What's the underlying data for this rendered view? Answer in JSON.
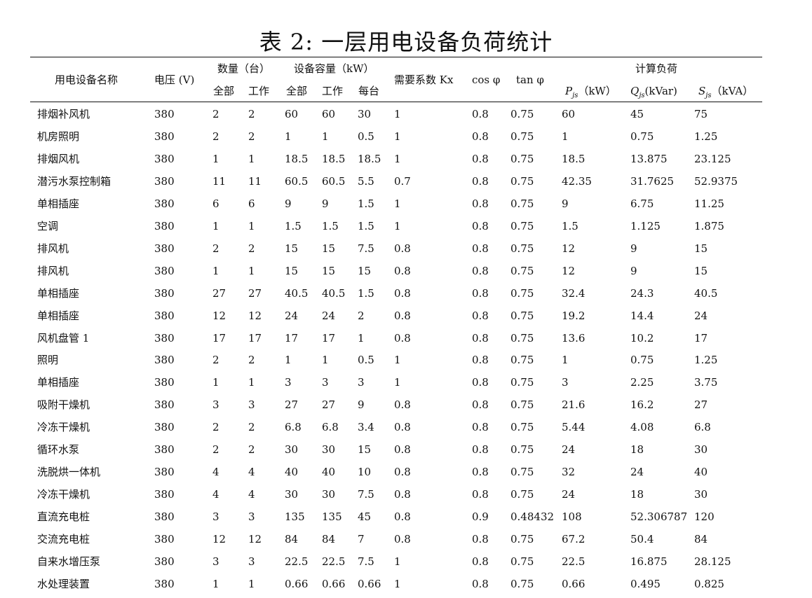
{
  "title": "表 2: 一层用电设备负荷统计",
  "header": {
    "name": "用电设备名称",
    "voltage": "电压 (V)",
    "quantity": "数量（台）",
    "qty_all": "全部",
    "qty_work": "工作",
    "capacity": "设备容量（kW）",
    "cap_all": "全部",
    "cap_work": "工作",
    "cap_each": "每台",
    "kx": "需要系数 Kx",
    "cos": "cos φ",
    "tan": "tan φ",
    "calc": "计算负荷",
    "pjs_symbol": "P",
    "pjs_sub": "js",
    "pjs_unit": "（kW）",
    "qjs_symbol": "Q",
    "qjs_sub": "js",
    "qjs_unit": "(kVar)",
    "sjs_symbol": "S",
    "sjs_sub": "js",
    "sjs_unit": "（kVA）"
  },
  "rows": [
    [
      "排烟补风机",
      "380",
      "2",
      "2",
      "60",
      "60",
      "30",
      "1",
      "0.8",
      "0.75",
      "60",
      "45",
      "75"
    ],
    [
      "机房照明",
      "380",
      "2",
      "2",
      "1",
      "1",
      "0.5",
      "1",
      "0.8",
      "0.75",
      "1",
      "0.75",
      "1.25"
    ],
    [
      "排烟风机",
      "380",
      "1",
      "1",
      "18.5",
      "18.5",
      "18.5",
      "1",
      "0.8",
      "0.75",
      "18.5",
      "13.875",
      "23.125"
    ],
    [
      "潜污水泵控制箱",
      "380",
      "11",
      "11",
      "60.5",
      "60.5",
      "5.5",
      "0.7",
      "0.8",
      "0.75",
      "42.35",
      "31.7625",
      "52.9375"
    ],
    [
      "单相插座",
      "380",
      "6",
      "6",
      "9",
      "9",
      "1.5",
      "1",
      "0.8",
      "0.75",
      "9",
      "6.75",
      "11.25"
    ],
    [
      "空调",
      "380",
      "1",
      "1",
      "1.5",
      "1.5",
      "1.5",
      "1",
      "0.8",
      "0.75",
      "1.5",
      "1.125",
      "1.875"
    ],
    [
      "排风机",
      "380",
      "2",
      "2",
      "15",
      "15",
      "7.5",
      "0.8",
      "0.8",
      "0.75",
      "12",
      "9",
      "15"
    ],
    [
      "排风机",
      "380",
      "1",
      "1",
      "15",
      "15",
      "15",
      "0.8",
      "0.8",
      "0.75",
      "12",
      "9",
      "15"
    ],
    [
      "单相插座",
      "380",
      "27",
      "27",
      "40.5",
      "40.5",
      "1.5",
      "0.8",
      "0.8",
      "0.75",
      "32.4",
      "24.3",
      "40.5"
    ],
    [
      "单相插座",
      "380",
      "12",
      "12",
      "24",
      "24",
      "2",
      "0.8",
      "0.8",
      "0.75",
      "19.2",
      "14.4",
      "24"
    ],
    [
      "风机盘管 1",
      "380",
      "17",
      "17",
      "17",
      "17",
      "1",
      "0.8",
      "0.8",
      "0.75",
      "13.6",
      "10.2",
      "17"
    ],
    [
      "照明",
      "380",
      "2",
      "2",
      "1",
      "1",
      "0.5",
      "1",
      "0.8",
      "0.75",
      "1",
      "0.75",
      "1.25"
    ],
    [
      "单相插座",
      "380",
      "1",
      "1",
      "3",
      "3",
      "3",
      "1",
      "0.8",
      "0.75",
      "3",
      "2.25",
      "3.75"
    ],
    [
      "吸附干燥机",
      "380",
      "3",
      "3",
      "27",
      "27",
      "9",
      "0.8",
      "0.8",
      "0.75",
      "21.6",
      "16.2",
      "27"
    ],
    [
      "冷冻干燥机",
      "380",
      "2",
      "2",
      "6.8",
      "6.8",
      "3.4",
      "0.8",
      "0.8",
      "0.75",
      "5.44",
      "4.08",
      "6.8"
    ],
    [
      "循环水泵",
      "380",
      "2",
      "2",
      "30",
      "30",
      "15",
      "0.8",
      "0.8",
      "0.75",
      "24",
      "18",
      "30"
    ],
    [
      "洗脱烘一体机",
      "380",
      "4",
      "4",
      "40",
      "40",
      "10",
      "0.8",
      "0.8",
      "0.75",
      "32",
      "24",
      "40"
    ],
    [
      "冷冻干燥机",
      "380",
      "4",
      "4",
      "30",
      "30",
      "7.5",
      "0.8",
      "0.8",
      "0.75",
      "24",
      "18",
      "30"
    ],
    [
      "直流充电桩",
      "380",
      "3",
      "3",
      "135",
      "135",
      "45",
      "0.8",
      "0.9",
      "0.48432",
      "108",
      "52.306787",
      "120"
    ],
    [
      "交流充电桩",
      "380",
      "12",
      "12",
      "84",
      "84",
      "7",
      "0.8",
      "0.8",
      "0.75",
      "67.2",
      "50.4",
      "84"
    ],
    [
      "自来水增压泵",
      "380",
      "3",
      "3",
      "22.5",
      "22.5",
      "7.5",
      "1",
      "0.8",
      "0.75",
      "22.5",
      "16.875",
      "28.125"
    ],
    [
      "水处理装置",
      "380",
      "1",
      "1",
      "0.66",
      "0.66",
      "0.66",
      "1",
      "0.8",
      "0.75",
      "0.66",
      "0.495",
      "0.825"
    ]
  ]
}
